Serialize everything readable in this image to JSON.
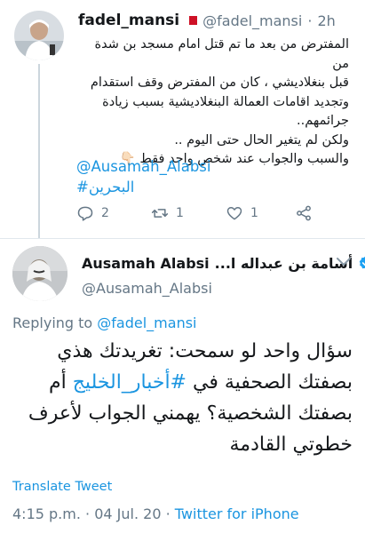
{
  "tweet1": {
    "name": "fadel_mansi",
    "handle": "@fadel_mansi",
    "separator": "·",
    "time": "2h",
    "lines": [
      "المفترض من بعد ما تم قتل امام مسجد بن شدة من",
      "قبل بنغلاديشي ، كان من المفترض وقف استقدام",
      "وتجديد اقامات العمالة البنغلاديشية بسبب زيادة",
      "جرائمهم..",
      "ولكن لم يتغير الحال حتى اليوم ..",
      "والسبب والجواب عند شخص واحد فقط 👇🏻"
    ],
    "mention": "@Ausamah_Alabsi",
    "hashtag": "#البحرين",
    "actions": {
      "reply_count": "2",
      "retweet_count": "1",
      "like_count": "1"
    },
    "icons": [
      "reply-icon",
      "retweet-icon",
      "like-icon",
      "share-icon"
    ]
  },
  "tweet2": {
    "name": "Ausamah Alabsi",
    "name_ar": "أسامة بن عبداله ا...",
    "handle": "@Ausamah_Alabsi",
    "replying_prefix": "Replying to",
    "replying_to": "@fadel_mansi",
    "body": {
      "line1": "سؤال واحد لو سمحت: تغريدتك هذي",
      "line2_pre": "بصفتك الصحفية في ",
      "line2_tag": "#أخبار_الخليج",
      "line2_post": " أم",
      "line3": "بصفتك الشخصية؟ يهمني الجواب لأعرف",
      "line4": "خطوتي القادمة"
    },
    "translate": "Translate Tweet",
    "time": "4:15 p.m.",
    "dot": "·",
    "date": "04 Jul. 20",
    "source": "Twitter for iPhone"
  },
  "colors": {
    "link": "#1b95e0",
    "muted": "#657786",
    "text": "#14171a",
    "flag": "#ce1126"
  }
}
